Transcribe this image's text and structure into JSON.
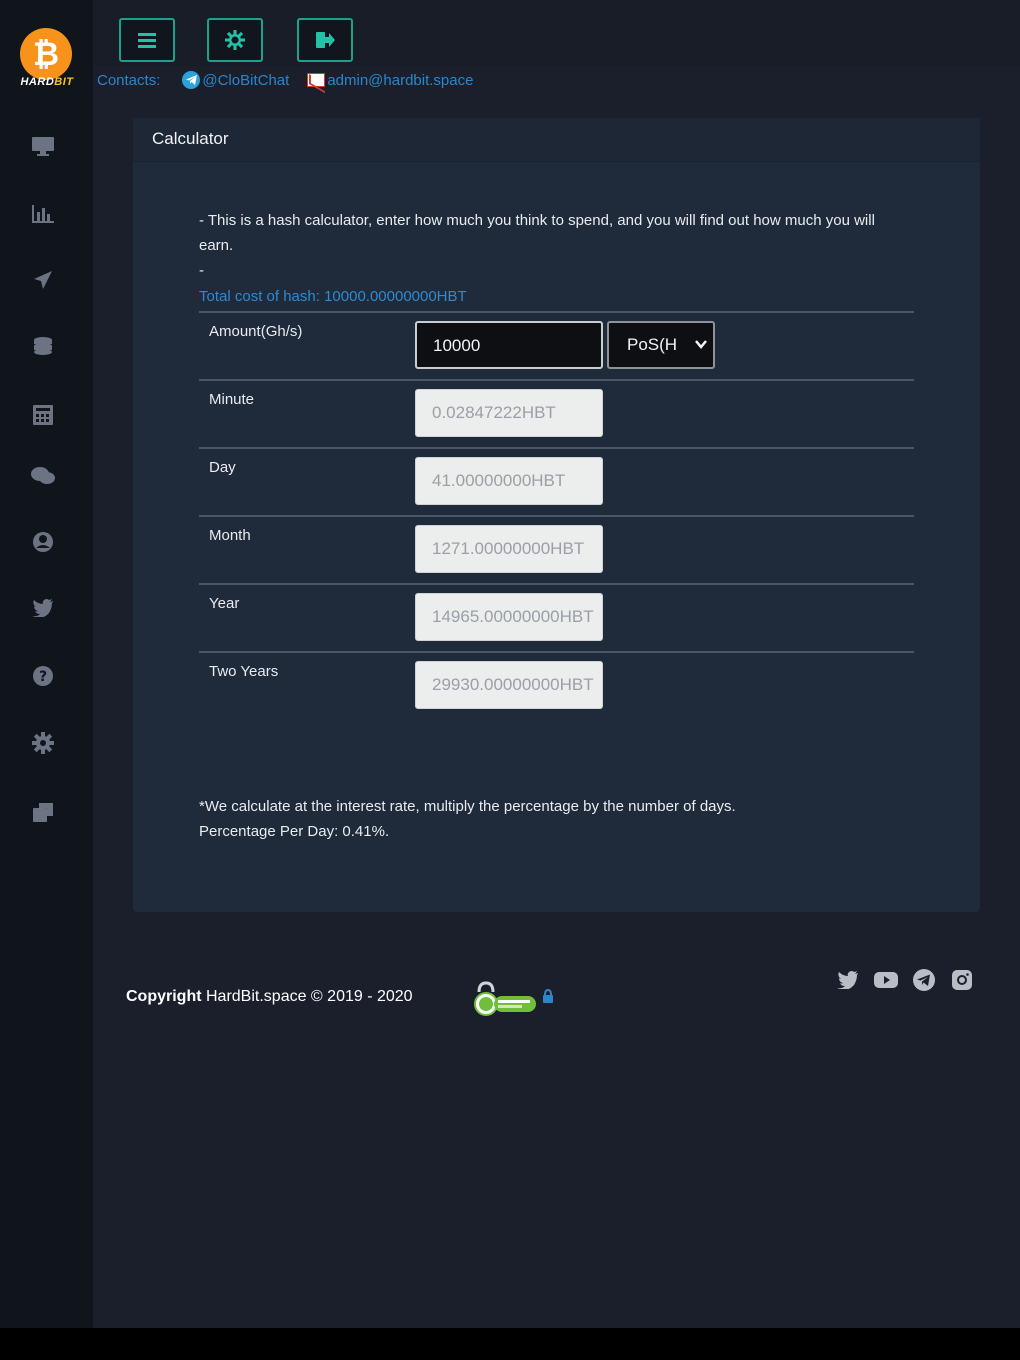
{
  "brand": {
    "logo_symbol": "₿",
    "logo_text_a": "HARD",
    "logo_text_b": "BIT"
  },
  "sidebar": {
    "icons": [
      "monitor-icon",
      "bar-chart-icon",
      "plane-icon",
      "database-icon",
      "calculator-icon",
      "chat-icon",
      "user-icon",
      "twitter-icon",
      "help-icon",
      "gear-icon",
      "wallet-icon"
    ]
  },
  "topbar": {
    "buttons": [
      "menu-icon",
      "settings-icon",
      "logout-icon"
    ]
  },
  "contacts": {
    "label": "Contacts:",
    "telegram": "@CloBitChat",
    "email": "admin@hardbit.space"
  },
  "calculator": {
    "title": "Calculator",
    "intro_line1": "- This is a hash calculator, enter how much you think to spend, and you will find out how much you will earn.",
    "intro_line2": "-",
    "total_cost": "Total cost of hash: 10000.00000000HBT",
    "amount_label": "Amount(Gh/s)",
    "amount_value": "10000",
    "unit_select": "PoS(H",
    "rows": [
      {
        "label": "Minute",
        "value": "0.02847222HBT"
      },
      {
        "label": "Day",
        "value": "41.00000000HBT"
      },
      {
        "label": "Month",
        "value": "1271.00000000HBT"
      },
      {
        "label": "Year",
        "value": "14965.00000000HBT"
      },
      {
        "label": "Two Years",
        "value": "29930.00000000HBT"
      }
    ],
    "note_line1": "*We calculate at the interest rate, multiply the percentage by the number of days.",
    "note_line2": "Percentage Per Day: 0.41%."
  },
  "footer": {
    "copyright_bold": "Copyright",
    "copyright_rest": " HardBit.space © 2019 - 2020",
    "socials": [
      "twitter-icon",
      "youtube-icon",
      "telegram-icon",
      "instagram-icon"
    ]
  },
  "colors": {
    "accent": "#1fa08a",
    "link": "#2d86c9",
    "card_bg": "#1f2a3a",
    "page_bg": "#1a1f2b"
  }
}
